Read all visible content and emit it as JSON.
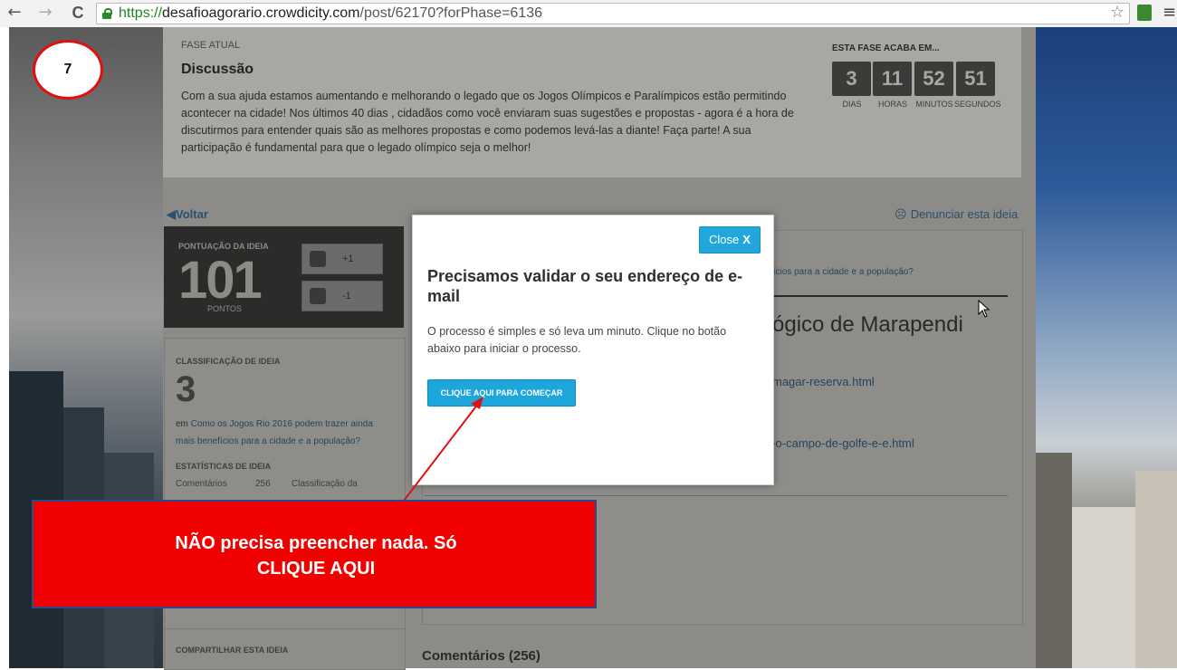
{
  "browser": {
    "url_scheme": "https://",
    "url_host": "desafioagorario.crowdicity.com",
    "url_path": "/post/62170?forPhase=6136",
    "back_glyph": "←",
    "forward_glyph": "→",
    "reload_glyph": "C",
    "star_glyph": "☆",
    "menu_glyph": "≡"
  },
  "phase": {
    "label": "FASE ATUAL",
    "title": "Discussão",
    "description": "Com a sua ajuda estamos aumentando e melhorando o legado que os Jogos Olímpicos e Paralímpicos estão permitindo acontecer na cidade! Nos últimos 40 dias , cidadãos como você enviaram suas sugestões e propostas - agora é a hora de discutirmos para entender quais são as melhores propostas e como podemos levá-las a diante! Faça parte! A sua participação é fundamental para que o legado olímpico seja o melhor!",
    "ends_label": "ESTA FASE ACABA EM...",
    "countdown": [
      {
        "value": "3",
        "unit": "DIAS"
      },
      {
        "value": "11",
        "unit": "HORAS"
      },
      {
        "value": "52",
        "unit": "MINUTOS"
      },
      {
        "value": "51",
        "unit": "SEGUNDOS"
      }
    ]
  },
  "nav": {
    "back_link": "◀Voltar",
    "report_link": "Denunciar esta ideia"
  },
  "score": {
    "label": "PONTUAÇÃO DA IDEIA",
    "value": "101",
    "unit": "PONTOS",
    "upvote": "+1",
    "downvote": "-1"
  },
  "classification": {
    "label": "CLASSIFICAÇÃO DE IDEIA",
    "rank": "3",
    "prefix": "em ",
    "challenge_link": "Como os Jogos Rio 2016 podem trazer ainda mais benefícios para a cidade e a população?",
    "stats_label": "ESTATÍSTICAS DE IDEIA",
    "comments_key": "Comentários",
    "comments_value": "256",
    "class_key": "Classificação da"
  },
  "share": {
    "label": "COMPARTILHAR ESTA IDEIA"
  },
  "idea": {
    "challenge_fragment": "fícios para a cidade e a população?",
    "title_fragment": "ógico de Marapendi",
    "link1_fragment": "magar-reserva.html",
    "link2_fragment": "o-o-campo-de-golfe-e-e.html"
  },
  "comments_heading": "Comentários (256)",
  "modal": {
    "close_label": "Close",
    "close_x": "X",
    "title": "Precisamos validar o seu endereço de e-mail",
    "body": "O processo é simples e só leva um minuto. Clique no botão abaixo para iniciar o processo.",
    "button": "CLIQUE AQUI PARA COMEÇAR"
  },
  "annotation": {
    "step": "7",
    "callout_line1": "NÃO precisa preencher nada. Só",
    "callout_line2": "CLIQUE AQUI"
  },
  "colors": {
    "accent": "#1da6dc",
    "callout": "#f00000",
    "callout_border": "#2d4d8a"
  }
}
